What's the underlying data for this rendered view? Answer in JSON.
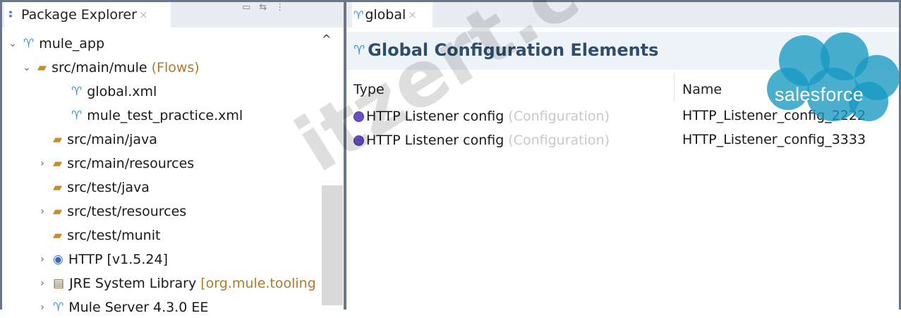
{
  "package_explorer": {
    "tab_title": "Package Explorer",
    "tab_close": "×",
    "tree": [
      {
        "label": "mule_app",
        "suffix": "",
        "twisty": "⌄",
        "icon": "mule-project-icon"
      },
      {
        "label": "src/main/mule",
        "suffix": "(Flows)",
        "twisty": "⌄",
        "icon": "source-folder-icon"
      },
      {
        "label": "global.xml",
        "suffix": "",
        "twisty": "",
        "icon": "mule-config-icon"
      },
      {
        "label": "mule_test_practice.xml",
        "suffix": "",
        "twisty": "",
        "icon": "mule-config-icon"
      },
      {
        "label": "src/main/java",
        "suffix": "",
        "twisty": "",
        "icon": "package-folder-icon"
      },
      {
        "label": "src/main/resources",
        "suffix": "",
        "twisty": "›",
        "icon": "package-folder-icon"
      },
      {
        "label": "src/test/java",
        "suffix": "",
        "twisty": "",
        "icon": "package-folder-icon"
      },
      {
        "label": "src/test/resources",
        "suffix": "",
        "twisty": "›",
        "icon": "package-folder-icon"
      },
      {
        "label": "src/test/munit",
        "suffix": "",
        "twisty": "",
        "icon": "source-folder-icon"
      },
      {
        "label": "HTTP [v1.5.24]",
        "suffix": "",
        "twisty": "›",
        "icon": "connector-icon"
      },
      {
        "label": "JRE System Library",
        "suffix": "[org.mule.tooling",
        "twisty": "›",
        "icon": "library-icon"
      },
      {
        "label": "Mule Server 4.3.0 EE",
        "suffix": "",
        "twisty": "›",
        "icon": "mule-server-icon"
      }
    ]
  },
  "editor": {
    "tab_title": "global",
    "tab_close": "×",
    "header_title": "Global Configuration Elements",
    "columns": {
      "type": "Type",
      "name": "Name"
    },
    "rows": [
      {
        "type": "HTTP Listener config",
        "type_suffix": "(Configuration)",
        "name": "HTTP_Listener_config_2222"
      },
      {
        "type": "HTTP Listener config",
        "type_suffix": "(Configuration)",
        "name": "HTTP_Listener_config_3333"
      }
    ]
  },
  "badge": {
    "text": "salesforce",
    "color": "#1798c1"
  },
  "watermark": {
    "text": "itzert.com"
  },
  "colors": {
    "accent": "#2f4e6b",
    "frame": "#6b7687"
  }
}
